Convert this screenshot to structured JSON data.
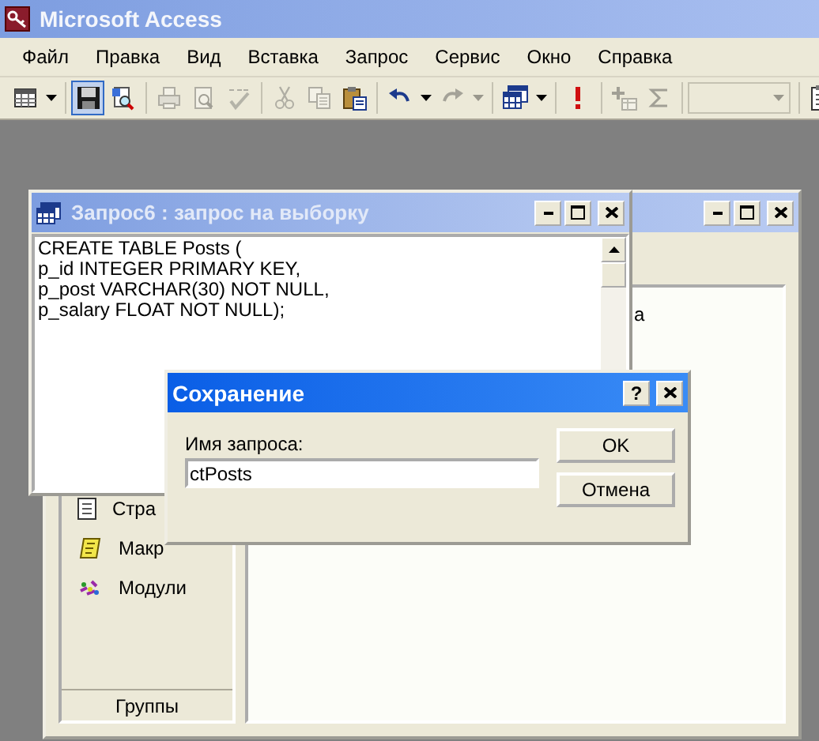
{
  "app": {
    "title": "Microsoft Access"
  },
  "menu": [
    {
      "label": "Файл"
    },
    {
      "label": "Правка"
    },
    {
      "label": "Вид"
    },
    {
      "label": "Вставка"
    },
    {
      "label": "Запрос"
    },
    {
      "label": "Сервис"
    },
    {
      "label": "Окно"
    },
    {
      "label": "Справка"
    }
  ],
  "toolbar": [
    {
      "kind": "button",
      "disabled": false,
      "selected": false
    },
    {
      "kind": "dropdown",
      "disabled": false
    },
    {
      "kind": "separator"
    },
    {
      "kind": "button",
      "disabled": false,
      "selected": true
    },
    {
      "kind": "button",
      "disabled": false,
      "selected": false
    },
    {
      "kind": "separator"
    },
    {
      "kind": "button",
      "disabled": true,
      "selected": false
    },
    {
      "kind": "button",
      "disabled": true,
      "selected": false
    },
    {
      "kind": "button",
      "disabled": true,
      "selected": false
    },
    {
      "kind": "separator"
    },
    {
      "kind": "button",
      "disabled": true,
      "selected": false
    },
    {
      "kind": "button",
      "disabled": true,
      "selected": false
    },
    {
      "kind": "button",
      "disabled": false,
      "selected": false
    },
    {
      "kind": "separator"
    },
    {
      "kind": "button",
      "disabled": false,
      "selected": false
    },
    {
      "kind": "dropdown",
      "disabled": false
    },
    {
      "kind": "button",
      "disabled": true,
      "selected": false
    },
    {
      "kind": "dropdown",
      "disabled": true
    },
    {
      "kind": "separator"
    },
    {
      "kind": "button",
      "disabled": false,
      "selected": false
    },
    {
      "kind": "dropdown",
      "disabled": false
    },
    {
      "kind": "separator"
    },
    {
      "kind": "button",
      "disabled": false,
      "selected": false
    },
    {
      "kind": "separator"
    },
    {
      "kind": "button",
      "disabled": true,
      "selected": false
    },
    {
      "kind": "button",
      "disabled": true,
      "selected": false
    },
    {
      "kind": "separator"
    },
    {
      "kind": "combo",
      "disabled": true
    },
    {
      "kind": "separator"
    },
    {
      "kind": "button",
      "disabled": false,
      "selected": false
    }
  ],
  "database_window": {
    "nav_items": [
      {
        "label": "Стра"
      },
      {
        "label": "Макр"
      },
      {
        "label": "Модули"
      }
    ],
    "groups_button": "Группы",
    "list_text": "а"
  },
  "query_window": {
    "title": "Запрос6 : запрос на выборку",
    "sql": "CREATE TABLE Posts (\np_id INTEGER PRIMARY KEY,\np_post VARCHAR(30) NOT NULL,\np_salary FLOAT NOT NULL);"
  },
  "dialog": {
    "title": "Сохранение",
    "help_button": "?",
    "field_label": "Имя запроса:",
    "field_value": "ctPosts",
    "buttons": [
      "OK",
      "Отмена"
    ]
  }
}
